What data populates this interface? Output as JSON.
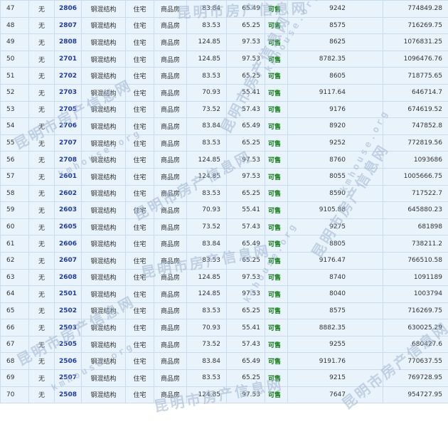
{
  "table": {
    "rows": [
      {
        "seq": "47",
        "mortgage": "无",
        "room": "2806",
        "structure": "钢混结构",
        "usage": "住宅",
        "house_type": "商品房",
        "area": "83.84",
        "inner_area": "65.49",
        "status": "可售",
        "unit_price": "9242",
        "total_price": "774849.28"
      },
      {
        "seq": "48",
        "mortgage": "无",
        "room": "2807",
        "structure": "钢混结构",
        "usage": "住宅",
        "house_type": "商品房",
        "area": "83.53",
        "inner_area": "65.25",
        "status": "可售",
        "unit_price": "8575",
        "total_price": "716269.75"
      },
      {
        "seq": "49",
        "mortgage": "无",
        "room": "2808",
        "structure": "钢混结构",
        "usage": "住宅",
        "house_type": "商品房",
        "area": "124.85",
        "inner_area": "97.53",
        "status": "可售",
        "unit_price": "8625",
        "total_price": "1076831.25"
      },
      {
        "seq": "50",
        "mortgage": "无",
        "room": "2701",
        "structure": "钢混结构",
        "usage": "住宅",
        "house_type": "商品房",
        "area": "124.85",
        "inner_area": "97.53",
        "status": "可售",
        "unit_price": "8782.35",
        "total_price": "1096476.76"
      },
      {
        "seq": "51",
        "mortgage": "无",
        "room": "2702",
        "structure": "钢混结构",
        "usage": "住宅",
        "house_type": "商品房",
        "area": "83.53",
        "inner_area": "65.25",
        "status": "可售",
        "unit_price": "8605",
        "total_price": "718775.65"
      },
      {
        "seq": "52",
        "mortgage": "无",
        "room": "2703",
        "structure": "钢混结构",
        "usage": "住宅",
        "house_type": "商品房",
        "area": "70.93",
        "inner_area": "55.41",
        "status": "可售",
        "unit_price": "9117.64",
        "total_price": "646714.7"
      },
      {
        "seq": "53",
        "mortgage": "无",
        "room": "2705",
        "structure": "钢混结构",
        "usage": "住宅",
        "house_type": "商品房",
        "area": "73.52",
        "inner_area": "57.43",
        "status": "可售",
        "unit_price": "9176",
        "total_price": "674619.52"
      },
      {
        "seq": "54",
        "mortgage": "无",
        "room": "2706",
        "structure": "钢混结构",
        "usage": "住宅",
        "house_type": "商品房",
        "area": "83.84",
        "inner_area": "65.49",
        "status": "可售",
        "unit_price": "8920",
        "total_price": "747852.8"
      },
      {
        "seq": "55",
        "mortgage": "无",
        "room": "2707",
        "structure": "钢混结构",
        "usage": "住宅",
        "house_type": "商品房",
        "area": "83.53",
        "inner_area": "65.25",
        "status": "可售",
        "unit_price": "9252",
        "total_price": "772819.56"
      },
      {
        "seq": "56",
        "mortgage": "无",
        "room": "2708",
        "structure": "钢混结构",
        "usage": "住宅",
        "house_type": "商品房",
        "area": "124.85",
        "inner_area": "97.53",
        "status": "可售",
        "unit_price": "8760",
        "total_price": "1093686"
      },
      {
        "seq": "57",
        "mortgage": "无",
        "room": "2601",
        "structure": "钢混结构",
        "usage": "住宅",
        "house_type": "商品房",
        "area": "124.85",
        "inner_area": "97.53",
        "status": "可售",
        "unit_price": "8055",
        "total_price": "1005666.75"
      },
      {
        "seq": "58",
        "mortgage": "无",
        "room": "2602",
        "structure": "钢混结构",
        "usage": "住宅",
        "house_type": "商品房",
        "area": "83.53",
        "inner_area": "65.25",
        "status": "可售",
        "unit_price": "8590",
        "total_price": "717522.7"
      },
      {
        "seq": "59",
        "mortgage": "无",
        "room": "2603",
        "structure": "钢混结构",
        "usage": "住宅",
        "house_type": "商品房",
        "area": "70.93",
        "inner_area": "55.41",
        "status": "可售",
        "unit_price": "9105.88",
        "total_price": "645880.23"
      },
      {
        "seq": "60",
        "mortgage": "无",
        "room": "2605",
        "structure": "钢混结构",
        "usage": "住宅",
        "house_type": "商品房",
        "area": "73.52",
        "inner_area": "57.43",
        "status": "可售",
        "unit_price": "9275",
        "total_price": "681898"
      },
      {
        "seq": "61",
        "mortgage": "无",
        "room": "2606",
        "structure": "钢混结构",
        "usage": "住宅",
        "house_type": "商品房",
        "area": "83.84",
        "inner_area": "65.49",
        "status": "可售",
        "unit_price": "8805",
        "total_price": "738211.2"
      },
      {
        "seq": "62",
        "mortgage": "无",
        "room": "2607",
        "structure": "钢混结构",
        "usage": "住宅",
        "house_type": "商品房",
        "area": "83.53",
        "inner_area": "65.25",
        "status": "可售",
        "unit_price": "9176.47",
        "total_price": "766510.58"
      },
      {
        "seq": "63",
        "mortgage": "无",
        "room": "2608",
        "structure": "钢混结构",
        "usage": "住宅",
        "house_type": "商品房",
        "area": "124.85",
        "inner_area": "97.53",
        "status": "可售",
        "unit_price": "8740",
        "total_price": "1091189"
      },
      {
        "seq": "64",
        "mortgage": "无",
        "room": "2501",
        "structure": "钢混结构",
        "usage": "住宅",
        "house_type": "商品房",
        "area": "124.85",
        "inner_area": "97.53",
        "status": "可售",
        "unit_price": "8040",
        "total_price": "1003794"
      },
      {
        "seq": "65",
        "mortgage": "无",
        "room": "2502",
        "structure": "钢混结构",
        "usage": "住宅",
        "house_type": "商品房",
        "area": "83.53",
        "inner_area": "65.25",
        "status": "可售",
        "unit_price": "8575",
        "total_price": "716269.75"
      },
      {
        "seq": "66",
        "mortgage": "无",
        "room": "2503",
        "structure": "钢混结构",
        "usage": "住宅",
        "house_type": "商品房",
        "area": "70.93",
        "inner_area": "55.41",
        "status": "可售",
        "unit_price": "8882.35",
        "total_price": "630025.29"
      },
      {
        "seq": "67",
        "mortgage": "无",
        "room": "2505",
        "structure": "钢混结构",
        "usage": "住宅",
        "house_type": "商品房",
        "area": "73.52",
        "inner_area": "57.43",
        "status": "可售",
        "unit_price": "9255",
        "total_price": "680427.6"
      },
      {
        "seq": "68",
        "mortgage": "无",
        "room": "2506",
        "structure": "钢混结构",
        "usage": "住宅",
        "house_type": "商品房",
        "area": "83.84",
        "inner_area": "65.49",
        "status": "可售",
        "unit_price": "9191.76",
        "total_price": "770637.55"
      },
      {
        "seq": "69",
        "mortgage": "无",
        "room": "2507",
        "structure": "钢混结构",
        "usage": "住宅",
        "house_type": "商品房",
        "area": "83.53",
        "inner_area": "65.25",
        "status": "可售",
        "unit_price": "9215",
        "total_price": "769728.95"
      },
      {
        "seq": "70",
        "mortgage": "无",
        "room": "2508",
        "structure": "钢混结构",
        "usage": "住宅",
        "house_type": "商品房",
        "area": "124.85",
        "inner_area": "97.53",
        "status": "可售",
        "unit_price": "7647",
        "total_price": "954727.95"
      }
    ]
  },
  "watermark": {
    "text_cn": "昆明市房产信息网",
    "text_url": "kmhouse.org"
  }
}
